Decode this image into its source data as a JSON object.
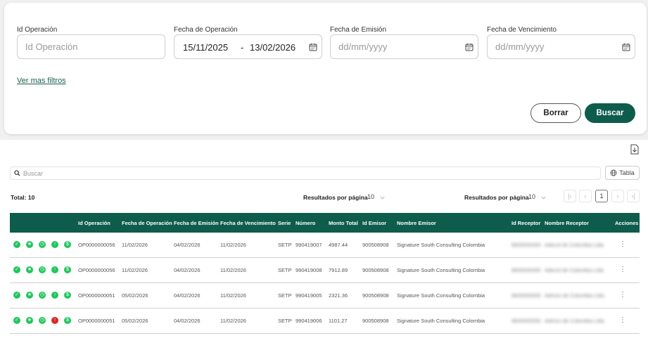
{
  "filters": {
    "id_label": "Id Operación",
    "id_placeholder": "Id Operación",
    "fecha_op_label": "Fecha de Operación",
    "fecha_op_from": "15/11/2025",
    "fecha_op_sep": "-",
    "fecha_op_to": "13/02/2026",
    "fecha_emision_label": "Fecha de Emisión",
    "fecha_emision_placeholder": "dd/mm/yyyy",
    "fecha_venc_label": "Fecha de Vencimiento",
    "fecha_venc_placeholder": "dd/mm/yyyy",
    "more_filters": "Ver mas filtros",
    "clear_label": "Borrar",
    "search_label": "Buscar"
  },
  "toolbar": {
    "search_placeholder": "Buscar",
    "view_label": "Tabla",
    "total": "Total: 10",
    "rpp_label": "Resultados por página",
    "rpp_value": "10",
    "rpp2_label": "Resultados por página",
    "rpp2_value": "10",
    "current_page": "1"
  },
  "table": {
    "headers": {
      "id_op": "Id Operación",
      "fecha_op": "Fecha de Operación",
      "fecha_em": "Fecha de Emisión",
      "fecha_ven": "Fecha de Vencimiento",
      "serie": "Serie",
      "numero": "Número",
      "monto": "Monto Total",
      "id_emisor": "Id Emisor",
      "nombre_emisor": "Nombre Emisor",
      "id_receptor": "Id Receptor",
      "nombre_receptor": "Nombre Receptor",
      "acciones": "Acciones"
    },
    "rows": [
      {
        "id_op": "OP0000000056",
        "fecha_op": "11/02/2026",
        "fecha_em": "04/02/2026",
        "fecha_ven": "11/02/2026",
        "serie": "SETP",
        "numero": "990419007",
        "monto": "4987.44",
        "id_emisor": "900508908",
        "nombre_emisor": "Signature South Consulting Colombia",
        "id_receptor": "8600000000",
        "nombre_receptor": "Adecol de Colombia Ltda",
        "status_red": false
      },
      {
        "id_op": "OP0000000056",
        "fecha_op": "11/02/2026",
        "fecha_em": "04/02/2026",
        "fecha_ven": "11/02/2026",
        "serie": "SETP",
        "numero": "990419008",
        "monto": "7912.89",
        "id_emisor": "900508908",
        "nombre_emisor": "Signature South Consulting Colombia",
        "id_receptor": "8600000000",
        "nombre_receptor": "Adecol de Colombia Ltda",
        "status_red": false
      },
      {
        "id_op": "OP0000000051",
        "fecha_op": "05/02/2026",
        "fecha_em": "04/02/2026",
        "fecha_ven": "11/02/2026",
        "serie": "SETP",
        "numero": "990419005",
        "monto": "2321.36",
        "id_emisor": "900508908",
        "nombre_emisor": "Signature South Consulting Colombia",
        "id_receptor": "8600000000",
        "nombre_receptor": "Admon de Colombia Ltda",
        "status_red": false
      },
      {
        "id_op": "OP0000000051",
        "fecha_op": "05/02/2026",
        "fecha_em": "04/02/2026",
        "fecha_ven": "11/02/2026",
        "serie": "SETP",
        "numero": "990419006",
        "monto": "1101.27",
        "id_emisor": "900508908",
        "nombre_emisor": "Signature South Consulting Colombia",
        "id_receptor": "8600000000",
        "nombre_receptor": "Admon de Colombia Ltda",
        "status_red": true
      }
    ]
  },
  "colors": {
    "primary": "#0d5c4c",
    "status_ok": "#22c55e",
    "status_alert": "#dc2626"
  },
  "icons": [
    "calendar-icon",
    "export-icon",
    "search-icon",
    "globe-icon",
    "chevron-down-icon",
    "first-page-icon",
    "prev-page-icon",
    "next-page-icon",
    "last-page-icon",
    "check-icon",
    "star-icon",
    "clock-icon",
    "arrow-up-icon",
    "dollar-icon",
    "kebab-icon"
  ]
}
